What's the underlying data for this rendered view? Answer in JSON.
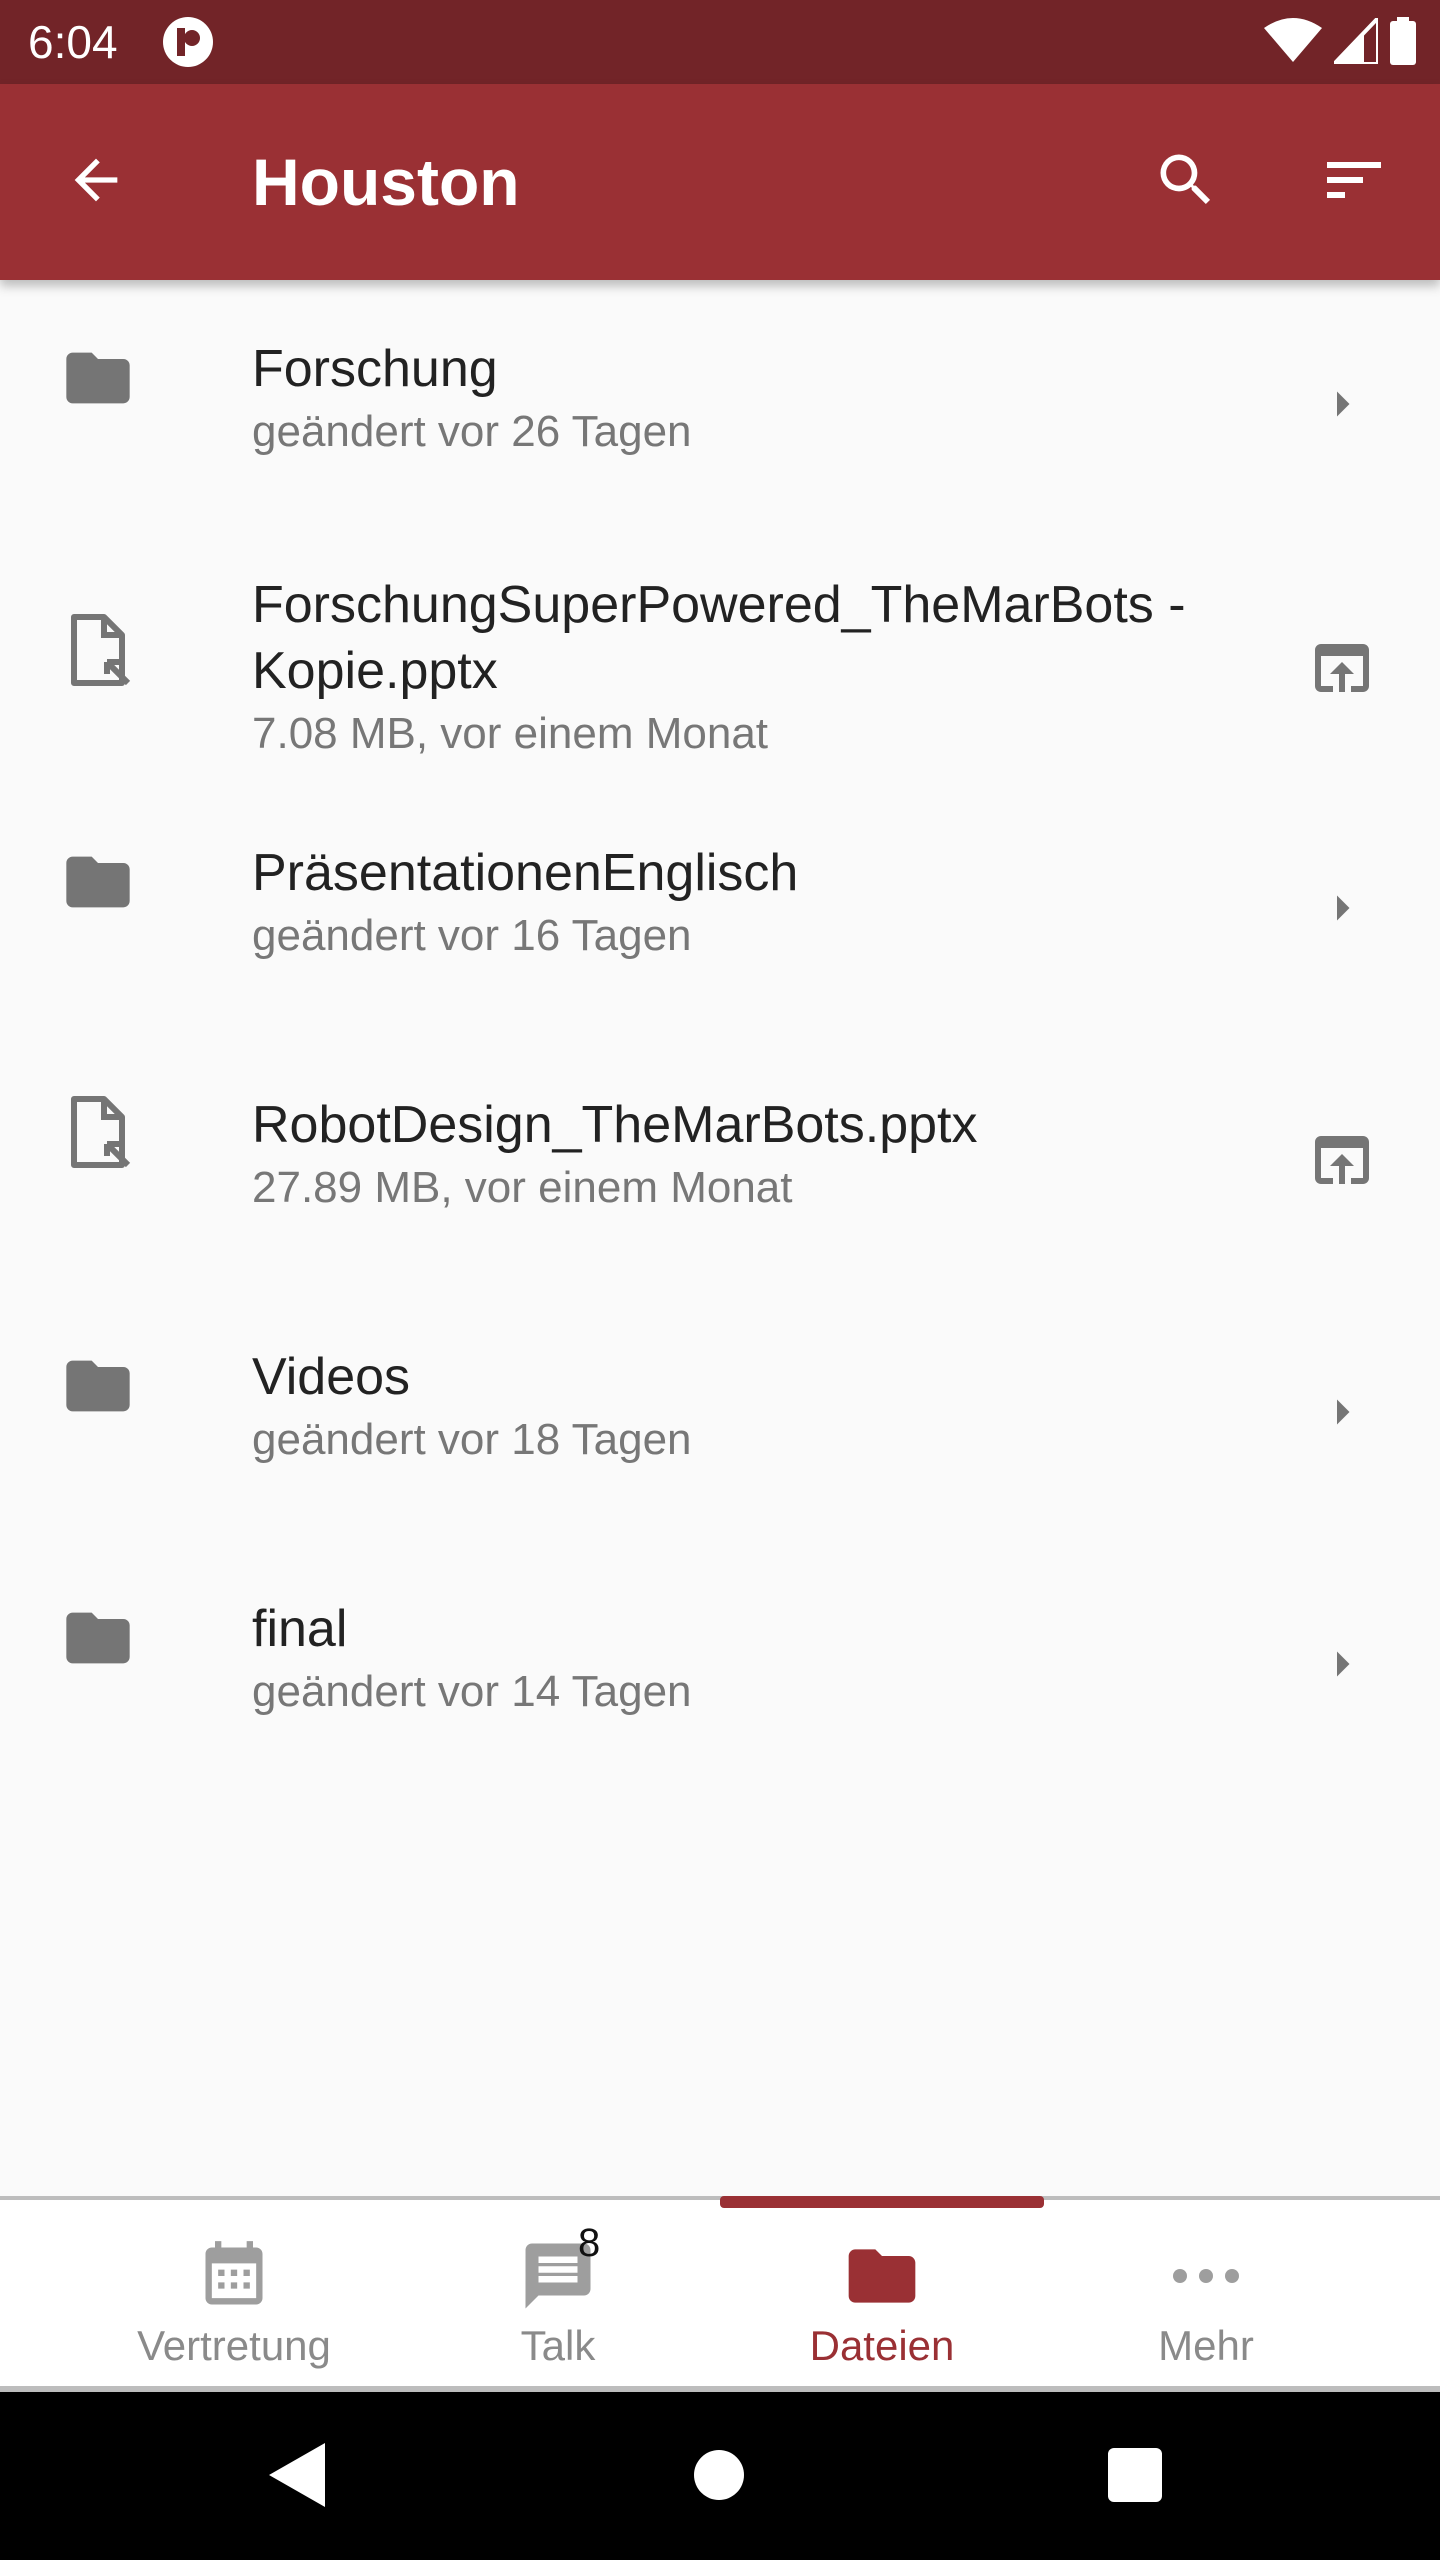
{
  "status_bar": {
    "time": "6:04"
  },
  "app_bar": {
    "title": "Houston",
    "back_icon": "arrow-back-icon",
    "search_icon": "search-icon",
    "sort_icon": "sort-icon"
  },
  "files": [
    {
      "type": "folder",
      "name": "Forschung",
      "meta": "geändert vor 26 Tagen"
    },
    {
      "type": "file",
      "name": "ForschungSuperPowered_TheMarBots - Kopie.pptx",
      "meta": "7.08 MB, vor einem Monat"
    },
    {
      "type": "folder",
      "name": "PräsentationenEnglisch",
      "meta": "geändert vor 16 Tagen"
    },
    {
      "type": "file",
      "name": "RobotDesign_TheMarBots.pptx",
      "meta": "27.89 MB, vor einem Monat"
    },
    {
      "type": "folder",
      "name": "Videos",
      "meta": "geändert vor 18 Tagen"
    },
    {
      "type": "folder",
      "name": "final",
      "meta": "geändert vor 14 Tagen"
    }
  ],
  "bottom_nav": {
    "items": [
      {
        "label": "Vertretung",
        "icon": "calendar-icon"
      },
      {
        "label": "Talk",
        "icon": "chat-icon",
        "badge": "8"
      },
      {
        "label": "Dateien",
        "icon": "folder-icon",
        "active": true
      },
      {
        "label": "Mehr",
        "icon": "more-horizontal-icon"
      }
    ]
  },
  "colors": {
    "status_bar": "#722428",
    "app_bar": "#9a3034",
    "accent": "#9a3034",
    "icon_gray": "#757575"
  }
}
